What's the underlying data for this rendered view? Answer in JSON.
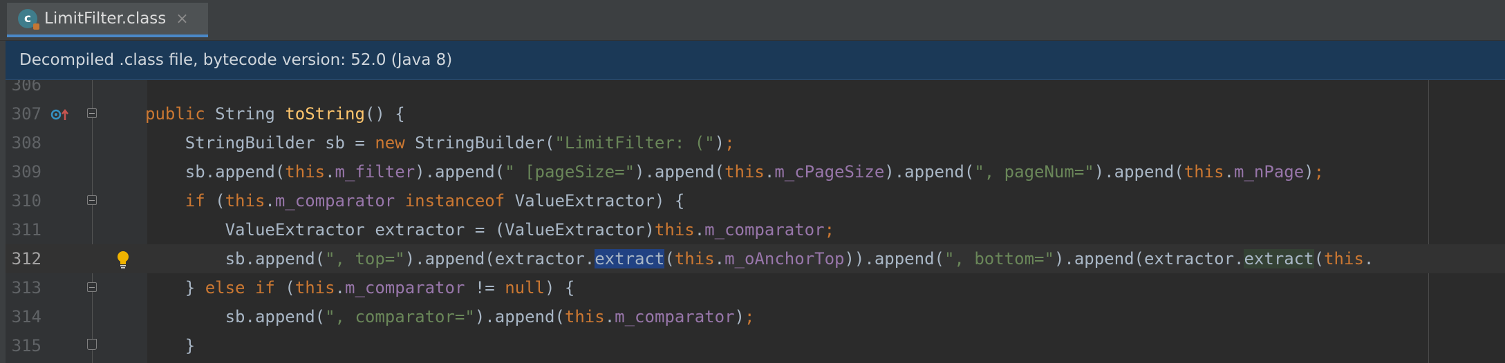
{
  "tab": {
    "icon": "c",
    "label": "LimitFilter.class",
    "close": "×"
  },
  "banner": {
    "text": "Decompiled .class file, bytecode version: 52.0 (Java 8)"
  },
  "lines": [
    {
      "number": "306",
      "tokens": []
    },
    {
      "number": "307",
      "tokens": [
        {
          "t": "public ",
          "c": "kw"
        },
        {
          "t": "String ",
          "c": ""
        },
        {
          "t": "toString",
          "c": "mt"
        },
        {
          "t": "() {",
          "c": ""
        }
      ]
    },
    {
      "number": "308",
      "tokens": [
        {
          "t": "    StringBuilder sb = ",
          "c": ""
        },
        {
          "t": "new ",
          "c": "kw"
        },
        {
          "t": "StringBuilder(",
          "c": ""
        },
        {
          "t": "\"LimitFilter: (\"",
          "c": "st"
        },
        {
          "t": ")",
          "c": ""
        },
        {
          "t": ";",
          "c": "kw"
        }
      ]
    },
    {
      "number": "309",
      "tokens": [
        {
          "t": "    sb.append(",
          "c": ""
        },
        {
          "t": "this",
          "c": "kw"
        },
        {
          "t": ".",
          "c": ""
        },
        {
          "t": "m_filter",
          "c": "fd"
        },
        {
          "t": ").append(",
          "c": ""
        },
        {
          "t": "\" [pageSize=\"",
          "c": "st"
        },
        {
          "t": ").append(",
          "c": ""
        },
        {
          "t": "this",
          "c": "kw"
        },
        {
          "t": ".",
          "c": ""
        },
        {
          "t": "m_cPageSize",
          "c": "fd"
        },
        {
          "t": ").append(",
          "c": ""
        },
        {
          "t": "\", pageNum=\"",
          "c": "st"
        },
        {
          "t": ").append(",
          "c": ""
        },
        {
          "t": "this",
          "c": "kw"
        },
        {
          "t": ".",
          "c": ""
        },
        {
          "t": "m_nPage",
          "c": "fd"
        },
        {
          "t": ")",
          "c": ""
        },
        {
          "t": ";",
          "c": "kw"
        }
      ]
    },
    {
      "number": "310",
      "tokens": [
        {
          "t": "    ",
          "c": ""
        },
        {
          "t": "if ",
          "c": "kw"
        },
        {
          "t": "(",
          "c": ""
        },
        {
          "t": "this",
          "c": "kw"
        },
        {
          "t": ".",
          "c": ""
        },
        {
          "t": "m_comparator ",
          "c": "fd"
        },
        {
          "t": "instanceof ",
          "c": "kw"
        },
        {
          "t": "ValueExtractor) {",
          "c": ""
        }
      ]
    },
    {
      "number": "311",
      "tokens": [
        {
          "t": "        ValueExtractor extractor = (ValueExtractor)",
          "c": ""
        },
        {
          "t": "this",
          "c": "kw"
        },
        {
          "t": ".",
          "c": ""
        },
        {
          "t": "m_comparator",
          "c": "fd"
        },
        {
          "t": ";",
          "c": "kw"
        }
      ]
    },
    {
      "number": "312",
      "tokens": [
        {
          "t": "        sb.append(",
          "c": ""
        },
        {
          "t": "\", top=\"",
          "c": "st"
        },
        {
          "t": ").append(extractor.",
          "c": ""
        },
        {
          "t": "extract",
          "c": "sel"
        },
        {
          "t": "(",
          "c": ""
        },
        {
          "t": "this",
          "c": "kw"
        },
        {
          "t": ".",
          "c": ""
        },
        {
          "t": "m_oAnchorTop",
          "c": "fd"
        },
        {
          "t": ")).append(",
          "c": ""
        },
        {
          "t": "\", bottom=\"",
          "c": "st"
        },
        {
          "t": ").append(extractor.",
          "c": ""
        },
        {
          "t": "extract",
          "c": "hl"
        },
        {
          "t": "(",
          "c": ""
        },
        {
          "t": "this",
          "c": "kw"
        },
        {
          "t": ".",
          "c": ""
        }
      ]
    },
    {
      "number": "313",
      "tokens": [
        {
          "t": "    } ",
          "c": ""
        },
        {
          "t": "else if ",
          "c": "kw"
        },
        {
          "t": "(",
          "c": ""
        },
        {
          "t": "this",
          "c": "kw"
        },
        {
          "t": ".",
          "c": ""
        },
        {
          "t": "m_comparator ",
          "c": "fd"
        },
        {
          "t": "!= ",
          "c": ""
        },
        {
          "t": "null",
          "c": "kw"
        },
        {
          "t": ") {",
          "c": ""
        }
      ]
    },
    {
      "number": "314",
      "tokens": [
        {
          "t": "        sb.append(",
          "c": ""
        },
        {
          "t": "\", comparator=\"",
          "c": "st"
        },
        {
          "t": ").append(",
          "c": ""
        },
        {
          "t": "this",
          "c": "kw"
        },
        {
          "t": ".",
          "c": ""
        },
        {
          "t": "m_comparator",
          "c": "fd"
        },
        {
          "t": ")",
          "c": ""
        },
        {
          "t": ";",
          "c": "kw"
        }
      ]
    },
    {
      "number": "315",
      "tokens": [
        {
          "t": "    }",
          "c": ""
        }
      ]
    }
  ],
  "colors": {
    "keyword": "#cc7832",
    "method": "#ffc66d",
    "string": "#6a8759",
    "field": "#9876aa",
    "text": "#a9b7c6",
    "selection": "#214283",
    "background": "#2b2b2b"
  }
}
